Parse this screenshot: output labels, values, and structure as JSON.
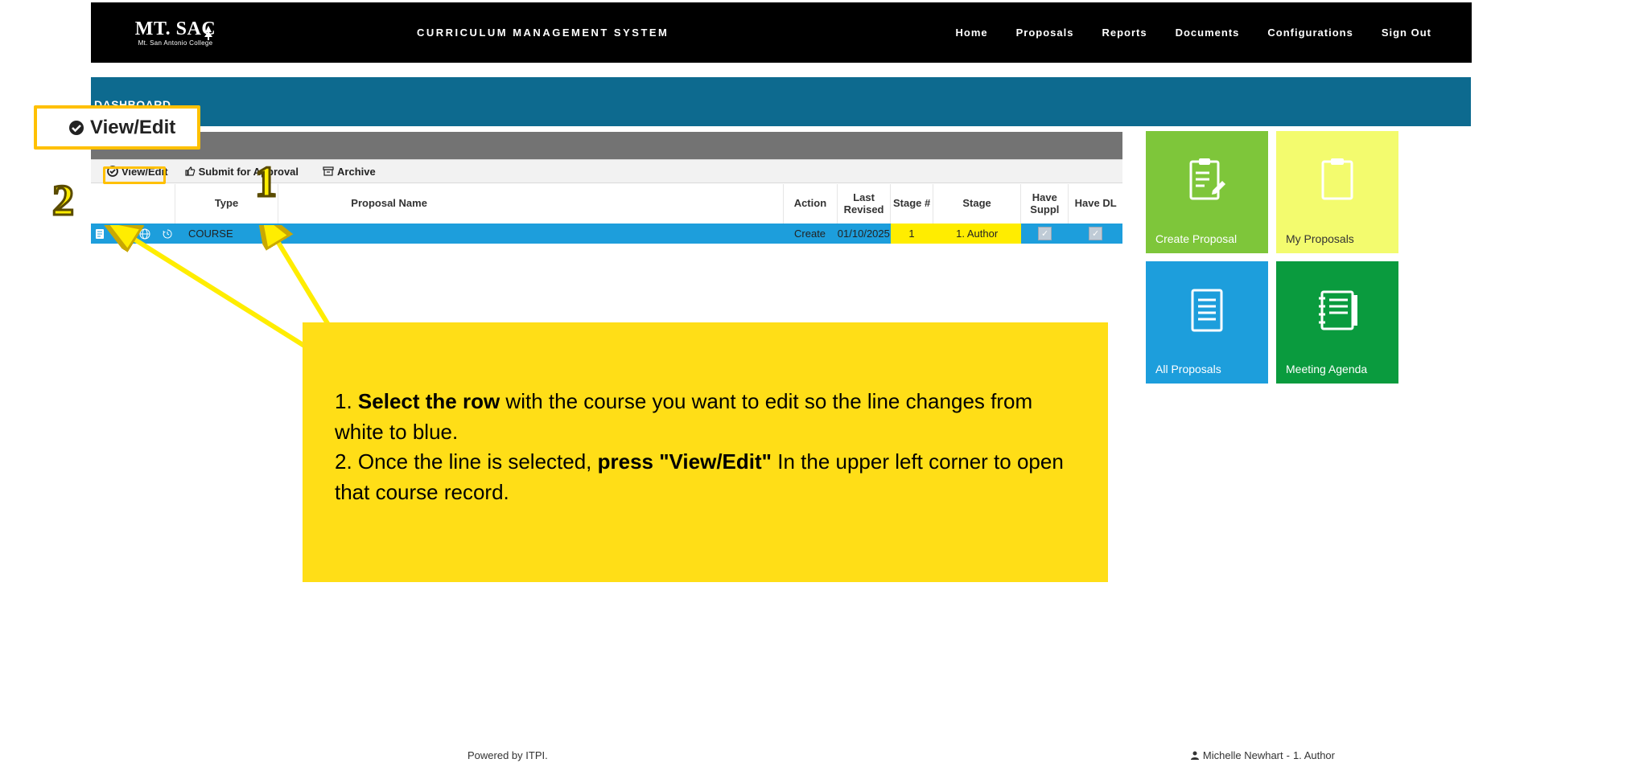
{
  "brand": {
    "name": "MT. SAC",
    "sub": "Mt. San Antonio College"
  },
  "app_title": "CURRICULUM MANAGEMENT SYSTEM",
  "nav": {
    "home": "Home",
    "proposals": "Proposals",
    "reports": "Reports",
    "documents": "Documents",
    "config": "Configurations",
    "signout": "Sign Out"
  },
  "dashboard_label": "DASHBOARD",
  "toolbar": {
    "view_edit": "View/Edit",
    "submit": "Submit for Approval",
    "archive": "Archive"
  },
  "columns": {
    "type": "Type",
    "name": "Proposal Name",
    "action": "Action",
    "last": "Last Revised",
    "stagen": "Stage #",
    "stage": "Stage",
    "suppl": "Have Suppl",
    "dl": "Have DL"
  },
  "row": {
    "type": "COURSE",
    "name": "",
    "action": "Create",
    "last": "01/10/2025",
    "stagen": "1",
    "stage": "1. Author"
  },
  "tiles": {
    "create": "Create Proposal",
    "my": "My Proposals",
    "all": "All Proposals",
    "agenda": "Meeting Agenda"
  },
  "callout": {
    "viewedit_label": "View/Edit",
    "num1": "1",
    "num2": "2",
    "instr_1a": "1. ",
    "instr_1b": "Select the row",
    "instr_1c": " with the course you want to edit so the line changes from white to blue.",
    "instr_2a": "2. Once the line is selected, ",
    "instr_2b": "press \"View/Edit\"",
    "instr_2c": " In the upper left corner to open that course record."
  },
  "footer": {
    "powered": "Powered by ITPI.",
    "user": "Michelle Newhart",
    "sep": " - ",
    "role": "1. Author"
  }
}
